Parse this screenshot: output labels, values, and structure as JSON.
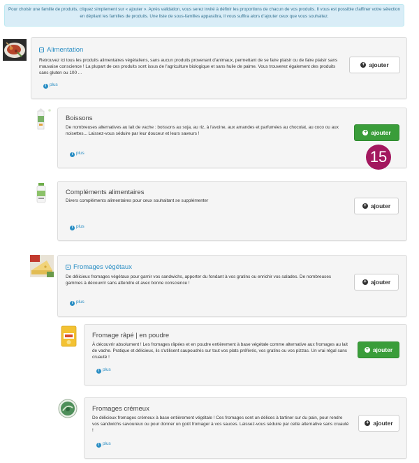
{
  "info_text": "Pour choisir une famille de produits, cliquez simplement sur « ajouter ». Après validation, vous serez invité à définir les proportions de chacun de vos produits. Il vous est possible d'affiner votre sélection en dépliant les familles de produits. Une liste de sous-familles apparaîtra, il vous suffira alors d'ajouter ceux que vous souhaitez.",
  "plus_label": "plus",
  "button_label": "ajouter",
  "step_badge": "15",
  "colors": {
    "accent": "#2a8ec4",
    "success": "#3a9d3a",
    "badge": "#a3185f",
    "info_bg": "#d9edf7"
  },
  "families": [
    {
      "title": "Alimentation",
      "description": "Retrouvez ici tous les produits alimentaires végétaliens, sans aucun produits provenant d'animaux, permettant de se faire plaisir ou de faire plaisir sans mauvaise conscience ! La plupart de ces produits sont issus de l'agriculture biologique et sans huile de palme. Vous trouverez également des produits sans gluten ou 100 ...",
      "expandable": true,
      "selected": false,
      "thumb_icon": "food-plate-icon"
    },
    {
      "title": "Boissons",
      "description": "De nombreuses alternatives au lait de vache : boissons au soja, au riz, à l'avoine, aux amandes et parfumées au chocolat, au coco ou aux noisettes... Laissez-vous séduire par leur douceur et leurs saveurs !",
      "expandable": false,
      "selected": true,
      "thumb_icon": "drink-carton-icon"
    },
    {
      "title": "Compléments alimentaires",
      "description": "Divers compléments alimentaires pour ceux souhaitant se supplémenter",
      "expandable": false,
      "selected": false,
      "thumb_icon": "supplement-bottle-icon"
    },
    {
      "title": "Fromages végétaux",
      "description": "De délicieux fromages végétaux pour garnir vos sandwichs, apporter du fondant à vos gratins ou enrichir vos salades. De nombreuses gammes à découvrir sans attendre et avec bonne conscience !",
      "expandable": true,
      "selected": false,
      "thumb_icon": "cheese-icon"
    },
    {
      "title": "Fromage râpé | en poudre",
      "description": "À découvrir absolument ! Les fromages râpées et en poudre entièrement à base végétale comme alternative aux fromages au lait de vache. Pratique et délicieux, ils s'utilisent saupoudrés sur tout vos plats préférés, vos gratins ou vos pizzas. Un vrai régal sans cruauté !",
      "expandable": false,
      "selected": true,
      "thumb_icon": "grated-cheese-pack-icon"
    },
    {
      "title": "Fromages crémeux",
      "description": "De délicieux fromages crémeux à base entièrement végétale ! Ces fromages sont un délices à tartiner sur du pain, pour rendre vos sandwichs savoureux ou pour donner un goût fromager à vos sauces. Laissez-vous séduire par cette alternative sans cruauté !",
      "expandable": false,
      "selected": false,
      "thumb_icon": "cream-cheese-tub-icon"
    }
  ]
}
